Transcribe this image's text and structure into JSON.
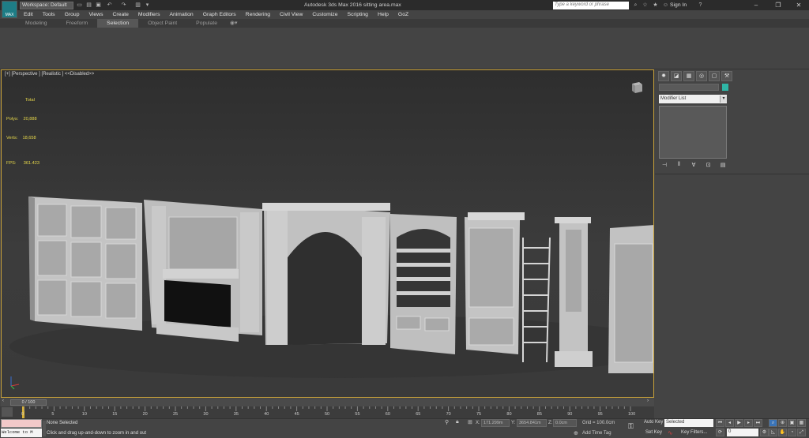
{
  "window": {
    "title": "Autodesk 3ds Max 2016    sitting area.max",
    "logo_text": "MAX",
    "workspace": "Workspace: Default",
    "search_placeholder": "Type a keyword or phrase",
    "sign_in": "Sign In"
  },
  "menu": [
    "Edit",
    "Tools",
    "Group",
    "Views",
    "Create",
    "Modifiers",
    "Animation",
    "Graph Editors",
    "Rendering",
    "Civil View",
    "Customize",
    "Scripting",
    "Help",
    "GoZ"
  ],
  "ribbon_tabs": [
    {
      "label": "Modeling",
      "active": false
    },
    {
      "label": "Freeform",
      "active": false
    },
    {
      "label": "Selection",
      "active": true
    },
    {
      "label": "Object Paint",
      "active": false
    },
    {
      "label": "Populate",
      "active": false
    }
  ],
  "viewport": {
    "label": "[+] [Perspective ] [Realistic ]  <<Disabled>>",
    "stats": {
      "header": "Total",
      "polys_label": "Polys:",
      "polys": "20,888",
      "verts_label": "Verts:",
      "verts": "18,658",
      "fps_label": "FPS:",
      "fps": "361.423"
    }
  },
  "command_panel": {
    "modifier_list": "Modifier List",
    "object_color": "#2fb6a6"
  },
  "timeline": {
    "frame_readout": "0 / 100",
    "ticks": [
      "0",
      "5",
      "10",
      "15",
      "20",
      "25",
      "30",
      "35",
      "40",
      "45",
      "50",
      "55",
      "60",
      "65",
      "70",
      "75",
      "80",
      "85",
      "90",
      "95",
      "100"
    ]
  },
  "status": {
    "selection": "None Selected",
    "prompt": "Click and drag up-and-down to zoom in and out",
    "welcome": "Welcome to M",
    "x_label": "X:",
    "x_value": "171.299m",
    "y_label": "Y:",
    "y_value": "3654.841m",
    "z_label": "Z:",
    "z_value": "0.0cm",
    "grid": "Grid = 100.0cm",
    "add_time_tag": "Add Time Tag",
    "auto_key": "Auto Key",
    "set_key": "Set Key",
    "selected": "Selected",
    "key_filters": "Key Filters...",
    "frame": "0"
  }
}
